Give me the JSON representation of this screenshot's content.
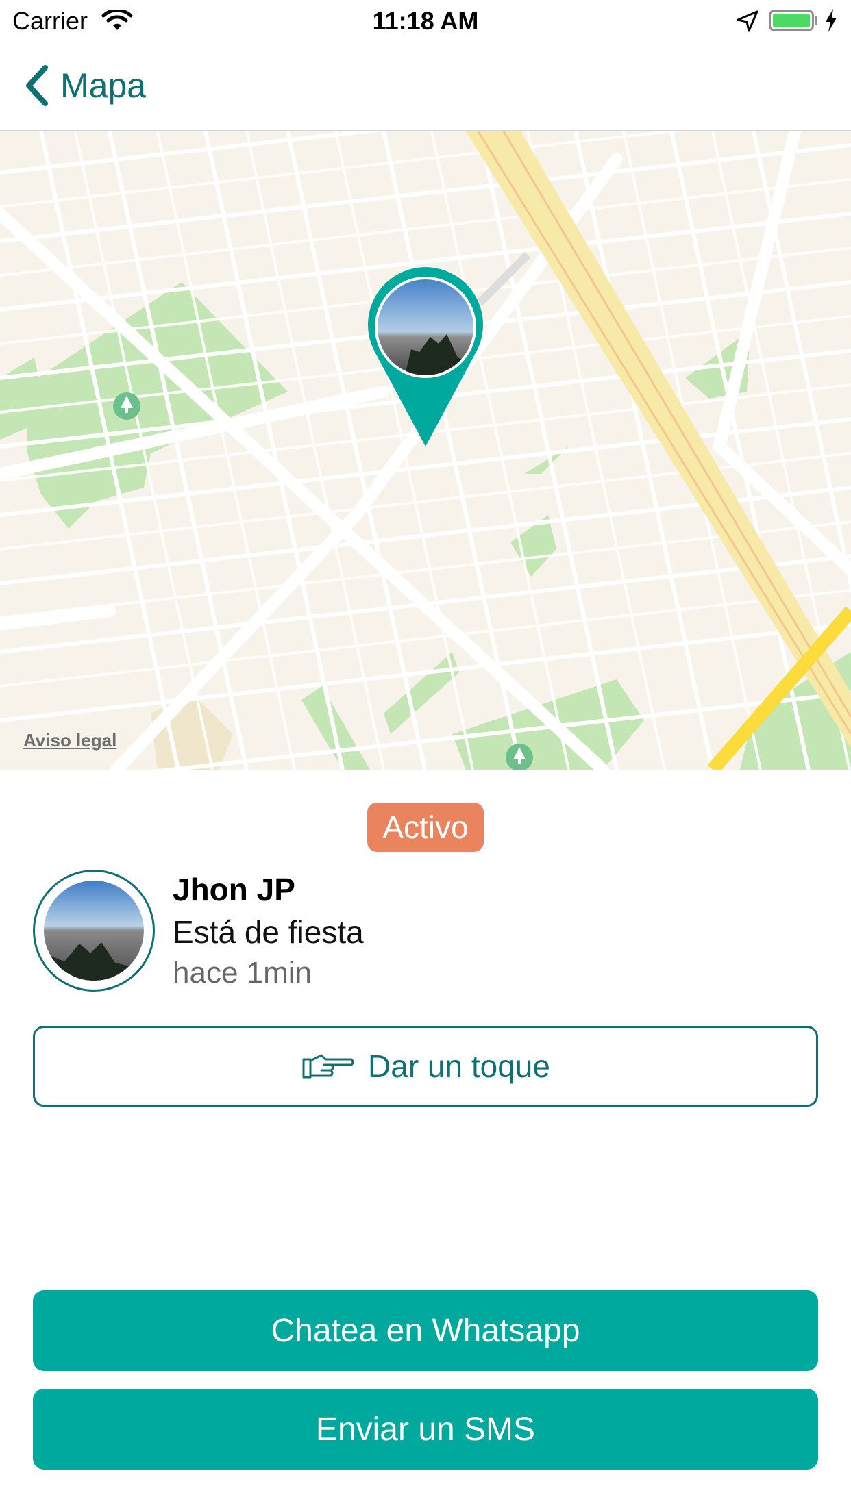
{
  "status_bar": {
    "carrier": "Carrier",
    "time": "11:18 AM",
    "icons": [
      "wifi-icon",
      "location-arrow-icon",
      "battery-icon",
      "charging-bolt-icon"
    ]
  },
  "nav": {
    "back_label": "Mapa",
    "back_icon": "chevron-left-icon"
  },
  "map": {
    "legal_link": "Aviso legal",
    "pin_icon": "map-pin-avatar",
    "park_icon": "tree-icon"
  },
  "profile": {
    "status": "Activo",
    "name": "Jhon JP",
    "activity": "Está de fiesta",
    "time_ago": "hace 1min"
  },
  "actions": {
    "poke_icon": "pointing-hand-icon",
    "poke_label": "Dar un toque",
    "whatsapp_label": "Chatea en Whatsapp",
    "sms_label": "Enviar un SMS"
  },
  "colors": {
    "accent": "#0f6f73",
    "primary": "#00a99d",
    "badge": "#e9845f",
    "map_background": "#f7f3ea",
    "park": "#c4e6b4",
    "highway": "#f7e9a8",
    "major_road": "#fbdc3c"
  }
}
